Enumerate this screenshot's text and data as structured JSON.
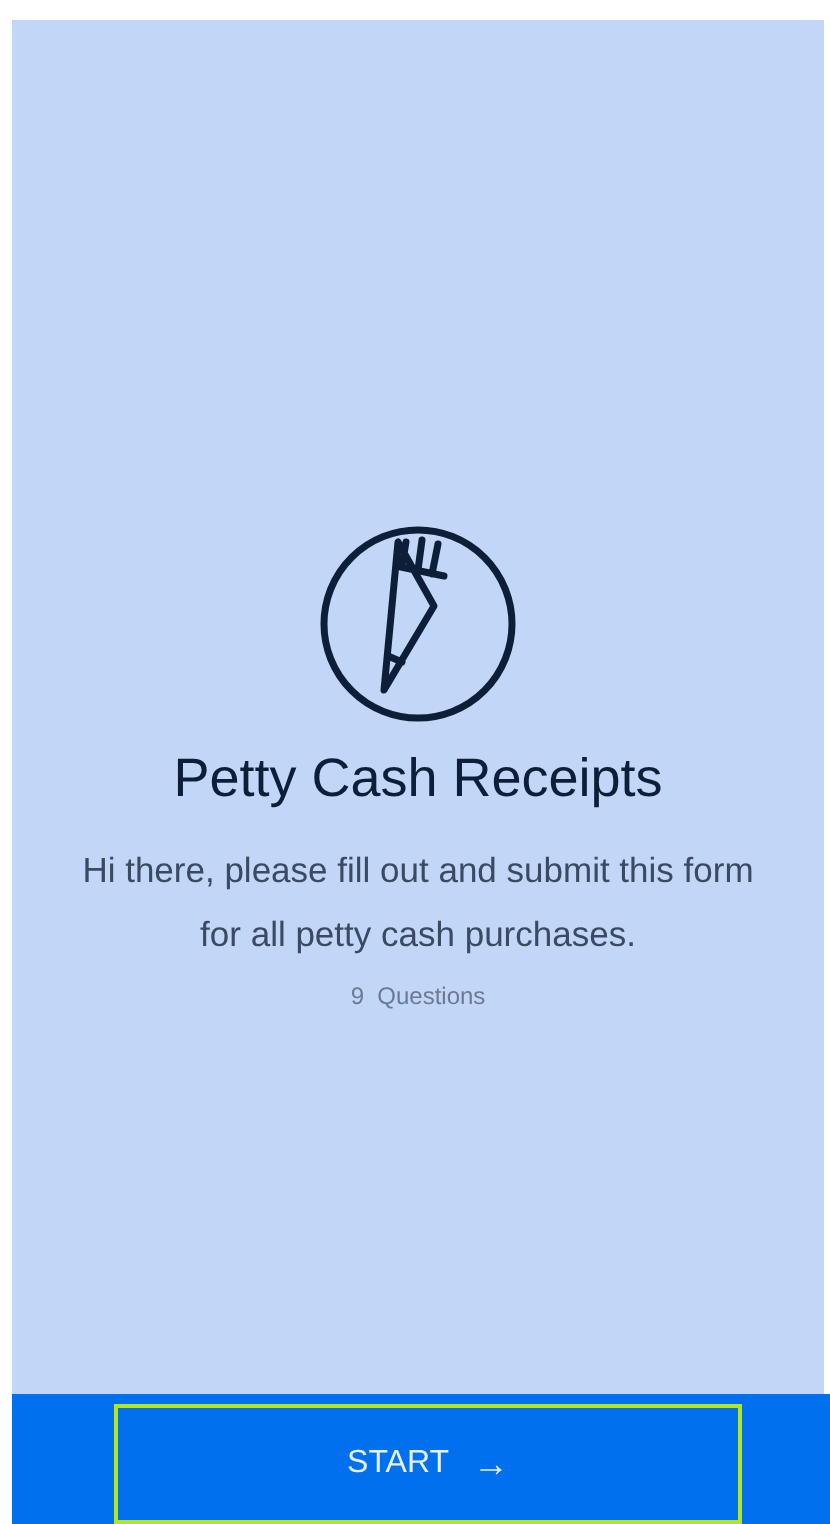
{
  "form": {
    "title": "Petty Cash Receipts",
    "description": "Hi there, please fill out and submit this form for all petty cash purchases.",
    "question_count": "9  Questions"
  },
  "start_button": {
    "label": "START",
    "arrow": "→"
  }
}
